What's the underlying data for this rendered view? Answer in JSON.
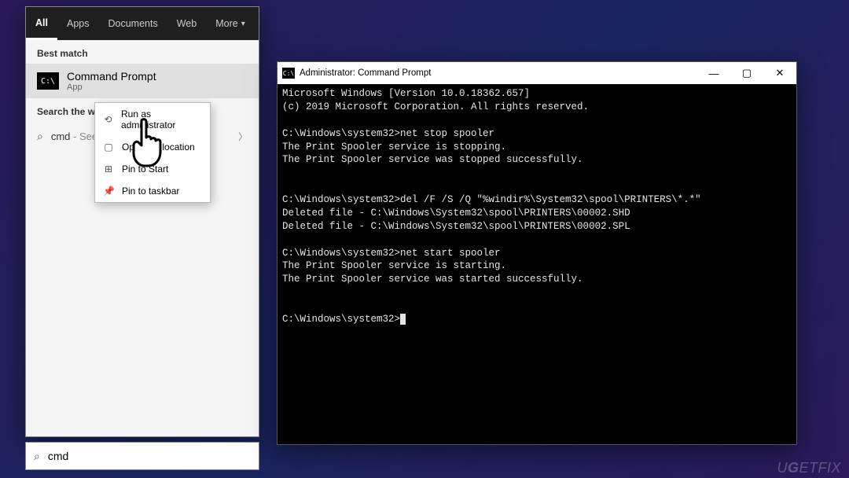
{
  "start": {
    "tabs": {
      "all": "All",
      "apps": "Apps",
      "documents": "Documents",
      "web": "Web",
      "more": "More"
    },
    "best_match_label": "Best match",
    "result": {
      "title": "Command Prompt",
      "subtitle": "App"
    },
    "search_web_label": "Search the web",
    "web_result": {
      "query": "cmd",
      "suffix": " - See web results"
    },
    "search_value": "cmd"
  },
  "context_menu": {
    "items": [
      {
        "icon": "⟲",
        "label": "Run as administrator"
      },
      {
        "icon": "▢",
        "label": "Open file location"
      },
      {
        "icon": "⊞",
        "label": "Pin to Start"
      },
      {
        "icon": "📌",
        "label": "Pin to taskbar"
      }
    ]
  },
  "cmd": {
    "title": "Administrator: Command Prompt",
    "lines": [
      "Microsoft Windows [Version 10.0.18362.657]",
      "(c) 2019 Microsoft Corporation. All rights reserved.",
      "",
      "C:\\Windows\\system32>net stop spooler",
      "The Print Spooler service is stopping.",
      "The Print Spooler service was stopped successfully.",
      "",
      "",
      "C:\\Windows\\system32>del /F /S /Q \"%windir%\\System32\\spool\\PRINTERS\\*.*\"",
      "Deleted file - C:\\Windows\\System32\\spool\\PRINTERS\\00002.SHD",
      "Deleted file - C:\\Windows\\System32\\spool\\PRINTERS\\00002.SPL",
      "",
      "C:\\Windows\\system32>net start spooler",
      "The Print Spooler service is starting.",
      "The Print Spooler service was started successfully.",
      "",
      "",
      "C:\\Windows\\system32>"
    ]
  },
  "watermark": "UGETFIX"
}
